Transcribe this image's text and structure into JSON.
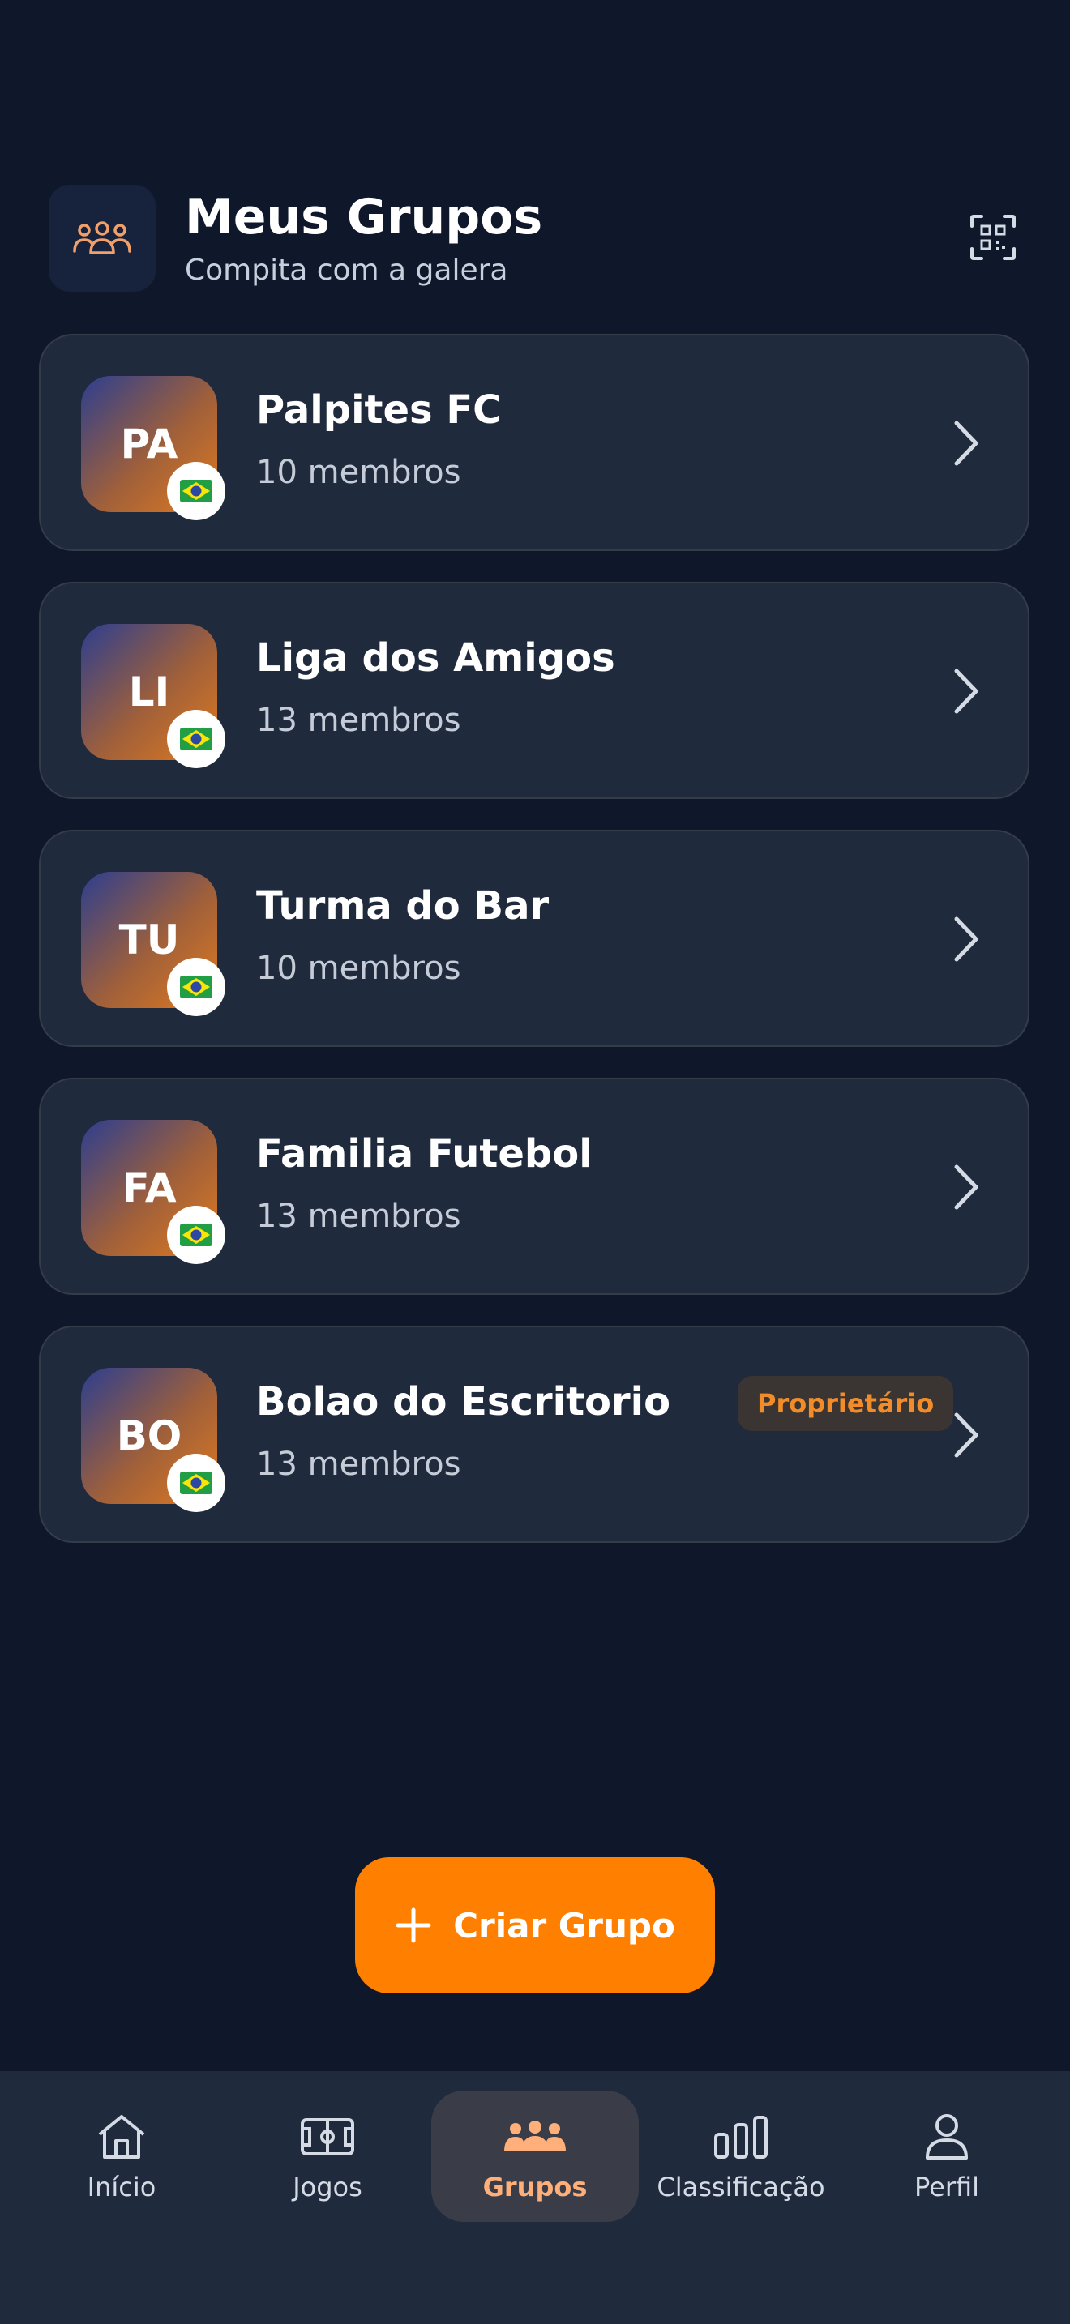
{
  "header": {
    "title": "Meus Grupos",
    "subtitle": "Compita com a galera",
    "icon": "group-icon",
    "qr_icon": "qr-scan-icon"
  },
  "groups": [
    {
      "initials": "PA",
      "name": "Palpites FC",
      "members": "10 membros",
      "flag": "brazil-flag-icon"
    },
    {
      "initials": "LI",
      "name": "Liga dos Amigos",
      "members": "13 membros",
      "flag": "brazil-flag-icon"
    },
    {
      "initials": "TU",
      "name": "Turma do Bar",
      "members": "10 membros",
      "flag": "brazil-flag-icon"
    },
    {
      "initials": "FA",
      "name": "Familia Futebol",
      "members": "13 membros",
      "flag": "brazil-flag-icon"
    },
    {
      "initials": "BO",
      "name": "Bolao do Escritorio",
      "members": "13 membros",
      "flag": "brazil-flag-icon",
      "badge": "Proprietário"
    }
  ],
  "create_button": {
    "label": "Criar Grupo",
    "icon": "plus-icon"
  },
  "nav": [
    {
      "label": "Início",
      "icon": "home-icon"
    },
    {
      "label": "Jogos",
      "icon": "soccer-field-icon"
    },
    {
      "label": "Grupos",
      "icon": "group-icon",
      "active": true
    },
    {
      "label": "Classificação",
      "icon": "bar-chart-icon"
    },
    {
      "label": "Perfil",
      "icon": "user-icon"
    }
  ],
  "colors": {
    "background": "#0f172a",
    "card": "#1f2a3d",
    "accent": "#ff7f00",
    "active_nav": "#ffb07a"
  }
}
